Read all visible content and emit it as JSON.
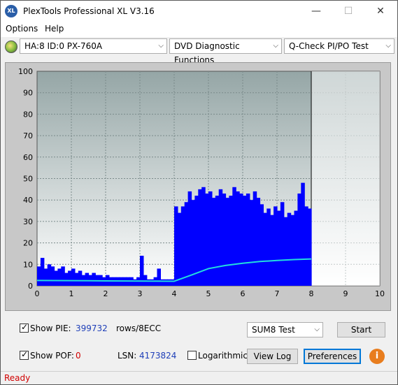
{
  "window": {
    "icon_text": "XL",
    "title": "PlexTools Professional XL V3.16",
    "minimize": "—",
    "maximize": "☐",
    "close": "✕"
  },
  "menu": {
    "options": "Options",
    "help": "Help"
  },
  "toolbar": {
    "drive": "HA:8 ID:0  PX-760A",
    "functions": "DVD Diagnostic Functions",
    "test": "Q-Check PI/PO Test",
    "arrow": "⌵"
  },
  "chart_data": {
    "type": "bar",
    "xlim": [
      0,
      10
    ],
    "ylim": [
      0,
      100
    ],
    "x_ticks": [
      "0",
      "1",
      "2",
      "3",
      "4",
      "5",
      "6",
      "7",
      "8",
      "9",
      "10"
    ],
    "y_ticks": [
      "0",
      "10",
      "20",
      "30",
      "40",
      "50",
      "60",
      "70",
      "80",
      "90",
      "100"
    ],
    "scan_end_x": 8,
    "grid": true,
    "series": [
      {
        "kind": "PIE bars",
        "color": "#0000ff",
        "x": [
          0.0,
          0.1,
          0.2,
          0.3,
          0.4,
          0.5,
          0.6,
          0.7,
          0.8,
          0.9,
          1.0,
          1.1,
          1.2,
          1.3,
          1.4,
          1.5,
          1.6,
          1.7,
          1.8,
          1.9,
          2.0,
          2.1,
          2.2,
          2.3,
          2.4,
          2.5,
          2.6,
          2.7,
          2.8,
          2.9,
          3.0,
          3.1,
          3.2,
          3.3,
          3.4,
          3.5,
          3.6,
          3.7,
          3.8,
          3.9,
          4.0,
          4.1,
          4.2,
          4.3,
          4.4,
          4.5,
          4.6,
          4.7,
          4.8,
          4.9,
          5.0,
          5.1,
          5.2,
          5.3,
          5.4,
          5.5,
          5.6,
          5.7,
          5.8,
          5.9,
          6.0,
          6.1,
          6.2,
          6.3,
          6.4,
          6.5,
          6.6,
          6.7,
          6.8,
          6.9,
          7.0,
          7.1,
          7.2,
          7.3,
          7.4,
          7.5,
          7.6,
          7.7,
          7.8,
          7.9,
          8.0
        ],
        "values": [
          9,
          13,
          8,
          10,
          9,
          7,
          8,
          9,
          6,
          7,
          8,
          6,
          7,
          5,
          6,
          5,
          6,
          5,
          5,
          4,
          5,
          4,
          4,
          4,
          4,
          4,
          4,
          4,
          3,
          4,
          14,
          5,
          3,
          3,
          4,
          8,
          3,
          3,
          3,
          3,
          37,
          34,
          37,
          39,
          44,
          40,
          42,
          45,
          46,
          43,
          44,
          41,
          42,
          45,
          43,
          41,
          42,
          46,
          44,
          43,
          42,
          43,
          40,
          44,
          41,
          38,
          34,
          36,
          33,
          37,
          35,
          39,
          32,
          34,
          33,
          35,
          43,
          48,
          37,
          36,
          30
        ]
      },
      {
        "kind": "PIE total",
        "color": "#22dddd",
        "x": [
          0,
          1,
          2,
          3,
          4,
          4.5,
          5,
          5.5,
          6,
          6.5,
          7,
          7.5,
          8
        ],
        "values": [
          2.5,
          2.4,
          2.3,
          2.2,
          2.1,
          5,
          8,
          9.5,
          10.5,
          11.3,
          11.8,
          12.2,
          12.5
        ]
      }
    ]
  },
  "bottom": {
    "show_pie_label": "Show PIE:",
    "pie_value": "399732",
    "rows_label": "rows/8ECC",
    "sum_select": "SUM8 Test",
    "start_button": "Start",
    "show_pof_label": "Show POF:",
    "pof_value": "0",
    "lsn_label": "LSN:",
    "lsn_value": "4173824",
    "logarithmic_label": "Logarithmic",
    "view_log_button": "View Log",
    "preferences_button": "Preferences",
    "info_glyph": "i"
  },
  "status": {
    "text": "Ready"
  }
}
